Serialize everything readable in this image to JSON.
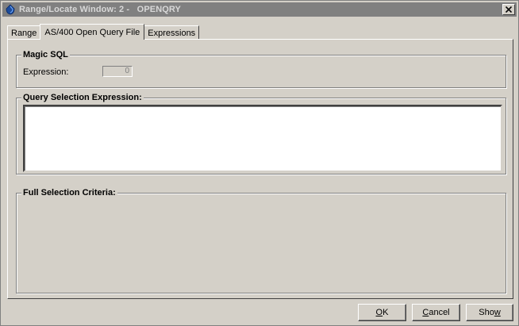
{
  "window": {
    "title": "Range/Locate Window: 2 -   OPENQRY"
  },
  "tabs": [
    {
      "label": "Range",
      "active": false
    },
    {
      "label": "AS/400 Open Query File",
      "active": true
    },
    {
      "label": "Expressions",
      "active": false
    }
  ],
  "magic_sql": {
    "title": "Magic SQL",
    "expression_label": "Expression:",
    "expression_value": "0"
  },
  "query_selection": {
    "title": "Query Selection Expression:",
    "value": ""
  },
  "full_selection": {
    "title": "Full Selection Criteria:"
  },
  "buttons": {
    "ok": {
      "mnemonic": "O",
      "rest": "K"
    },
    "cancel": {
      "mnemonic": "C",
      "rest": "ancel"
    },
    "show": {
      "prefix": "Sho",
      "mnemonic": "w"
    }
  },
  "colors": {
    "face": "#d4d0c8",
    "titlebar_inactive": "#808080"
  }
}
